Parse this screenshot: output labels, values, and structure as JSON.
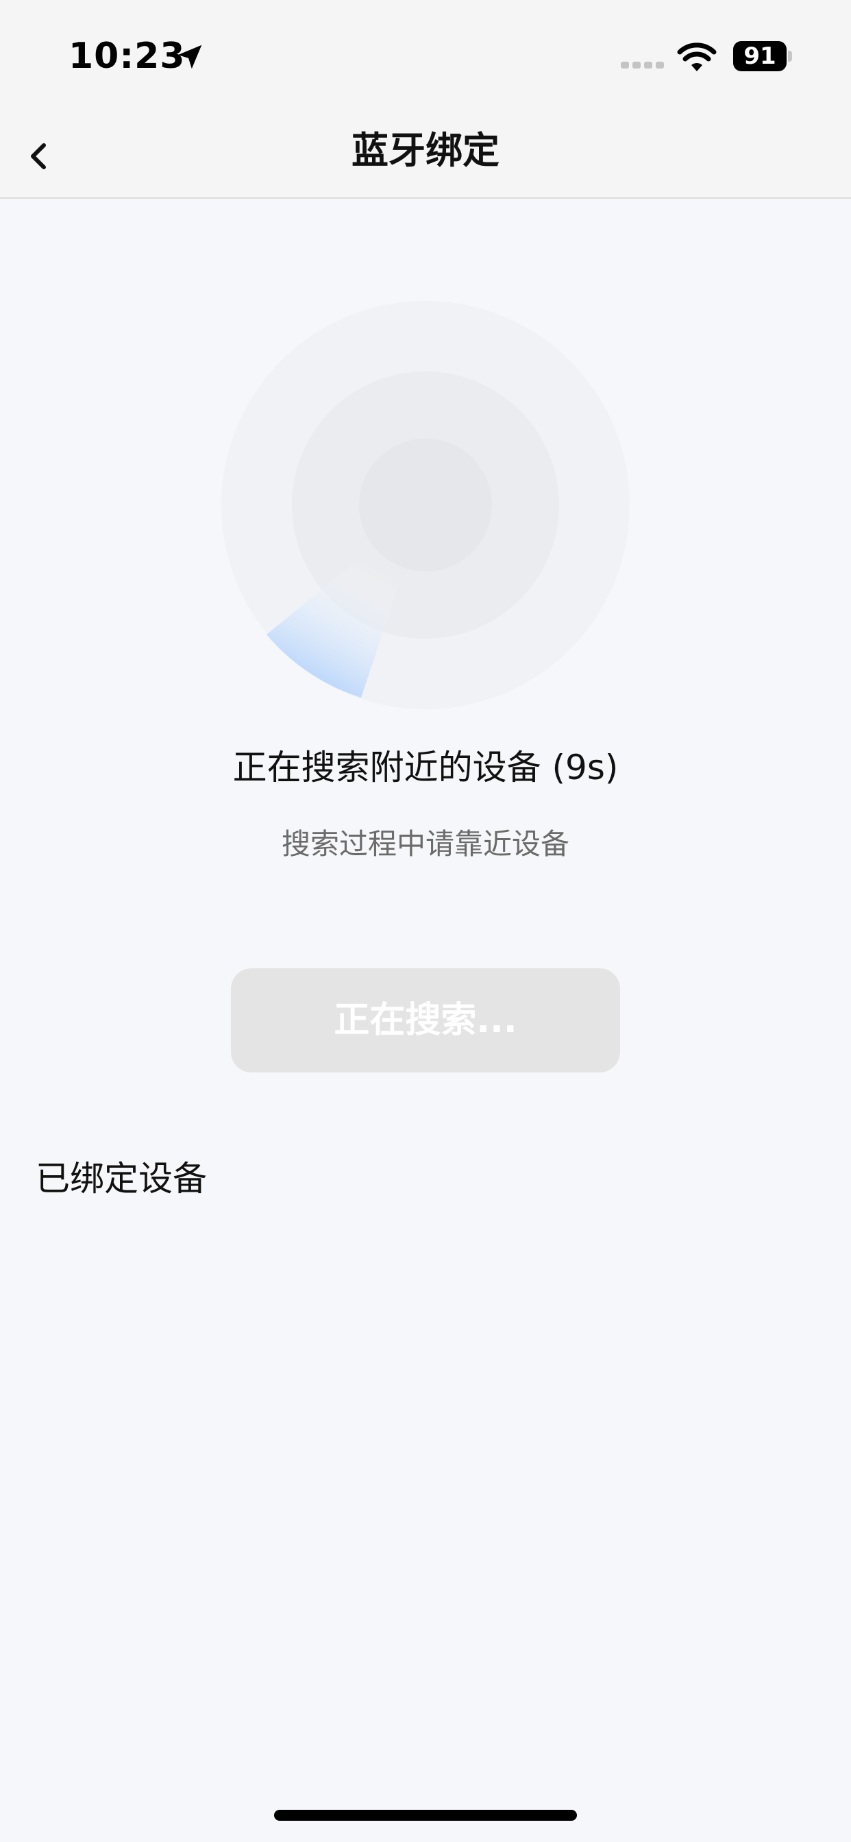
{
  "status_bar": {
    "time": "10:23",
    "battery": "91",
    "icons": [
      "location-arrow-icon",
      "signal-icon",
      "wifi-icon",
      "battery-icon"
    ]
  },
  "nav": {
    "title": "蓝牙绑定",
    "back_icon": "chevron-left-icon"
  },
  "search": {
    "status": "正在搜索附近的设备 (9s)",
    "hint": "搜索过程中请靠近设备",
    "button_label": "正在搜索..."
  },
  "bound": {
    "title": "已绑定设备"
  },
  "colors": {
    "background": "#f6f7fa",
    "radar_outer": "#f1f2f5",
    "radar_middle": "#ebecef",
    "radar_inner": "#e6e7ea",
    "radar_sweep": "#b9d6fb",
    "button_disabled": "#e4e4e4"
  }
}
